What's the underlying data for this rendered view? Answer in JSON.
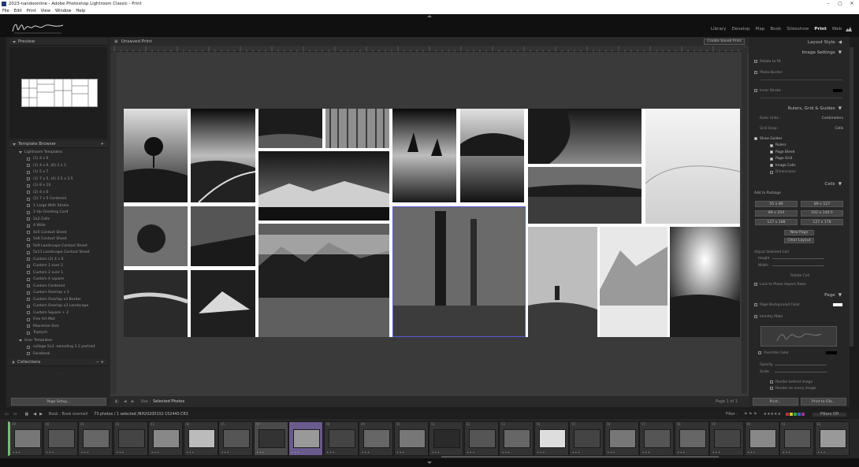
{
  "window": {
    "title": "2023-nandoonline - Adobe Photoshop Lightroom Classic - Print"
  },
  "menu": [
    "File",
    "Edit",
    "Print",
    "View",
    "Window",
    "Help"
  ],
  "modules": [
    {
      "label": "Library",
      "active": false
    },
    {
      "label": "Develop",
      "active": false
    },
    {
      "label": "Map",
      "active": false
    },
    {
      "label": "Book",
      "active": false
    },
    {
      "label": "Slideshow",
      "active": false
    },
    {
      "label": "Print",
      "active": true
    },
    {
      "label": "Web",
      "active": false
    }
  ],
  "left": {
    "preview_title": "Preview",
    "template_browser_title": "Template Browser",
    "lightroom_templates": "Lightroom Templates",
    "templates": [
      "(1) 4 x 6",
      "(1) 4 x 6, (6) 2 x 3",
      "(1) 5 x 7",
      "(1) 7 x 5, (4) 2.5 x 3.5",
      "(1) 8 x 10",
      "(2) 4 x 6",
      "(2) 7 x 5 Centered",
      "1 Large With Stroke",
      "2-Up Greeting Card",
      "2x2 Cells",
      "4 Wide",
      "4x5 Contact Sheet",
      "5x8 Contact Sheet",
      "5x9 Landscape Contact Sheet",
      "5x11 Landscape Contact Sheet",
      "Custom (2) 4 x 6",
      "Custom 1 over 2",
      "Custom 2 over 1",
      "Custom 4 square",
      "Custom Centered",
      "Custom Overlap x 3",
      "Custom Overlap x3 Border",
      "Custom Overlap x3 Landscape",
      "Custom Square + 2",
      "Fine Art Mat",
      "Maximize Size",
      "Triptych"
    ],
    "user_templates": "User Templates",
    "user_items": [
      "collage 5x3 -nenoding 3 2 portrait",
      "Facebook"
    ],
    "collections_title": "Collections",
    "page_setup": "Page Setup..."
  },
  "center": {
    "doc_title": "Unsaved Print",
    "create_saved": "Create Saved Print",
    "use_label": "Use :",
    "use_value": "Selected Photos",
    "page_count": "Page 1 of 1"
  },
  "right": {
    "layout_style": "Layout Style",
    "image_settings": "Image Settings",
    "rotate_to_fit": "Rotate to Fit",
    "photo_border": "Photo Border",
    "inner_stroke": "Inner Stroke",
    "rulers_title": "Rulers, Grid & Guides",
    "ruler_units_label": "Ruler Units :",
    "ruler_units_value": "Centimeters",
    "grid_snap_label": "Grid Snap :",
    "grid_snap_value": "Cells",
    "show_guides": "Show Guides",
    "guides": [
      {
        "label": "Rulers",
        "on": true
      },
      {
        "label": "Page Bleed",
        "on": true
      },
      {
        "label": "Page Grid",
        "on": true
      },
      {
        "label": "Image Cells",
        "on": true
      },
      {
        "label": "Dimensions",
        "on": false
      }
    ],
    "cells_title": "Cells",
    "add_to_package": "Add to Package",
    "cell_sizes": [
      "55 x 89",
      "89 x 127",
      "89 x 254",
      "102 x 140.5",
      "127 x 188",
      "127 x 178"
    ],
    "new_page": "New Page",
    "clear_layout": "Clear Layout",
    "adjust_selected": "Adjust Selected Cell",
    "height": "Height",
    "width": "Width",
    "rotate_cell": "Rotate Cell",
    "lock_aspect": "Lock to Photo Aspect Ratio",
    "page_title": "Page",
    "page_bg": "Page Background Color",
    "identity_plate": "Identity Plate",
    "override_color": "Override Color",
    "opacity": "Opacity",
    "scale": "Scale",
    "render_behind": "Render behind image",
    "render_every": "Render on every image",
    "print": "Print...",
    "print_to_file": "Print to File..."
  },
  "toolbar": {
    "source": "Book : Book overnell",
    "count": "73 photos / 1 selected /NH20200102-152440.CR3",
    "filter_label": "Filter :",
    "filters_off": "Filters Off"
  },
  "filmstrip": {
    "numbers": [
      "39",
      "40",
      "41",
      "42",
      "43",
      "44",
      "45",
      "46",
      "47",
      "48",
      "49",
      "50",
      "51",
      "52",
      "53",
      "54",
      "55",
      "56",
      "57",
      "58",
      "59",
      "60",
      "61",
      "62"
    ]
  },
  "colors": {
    "accent": "#e8e8e8",
    "panel": "#262626",
    "canvas": "#3a3a3a",
    "selected_purple": "#6b5a8e"
  }
}
